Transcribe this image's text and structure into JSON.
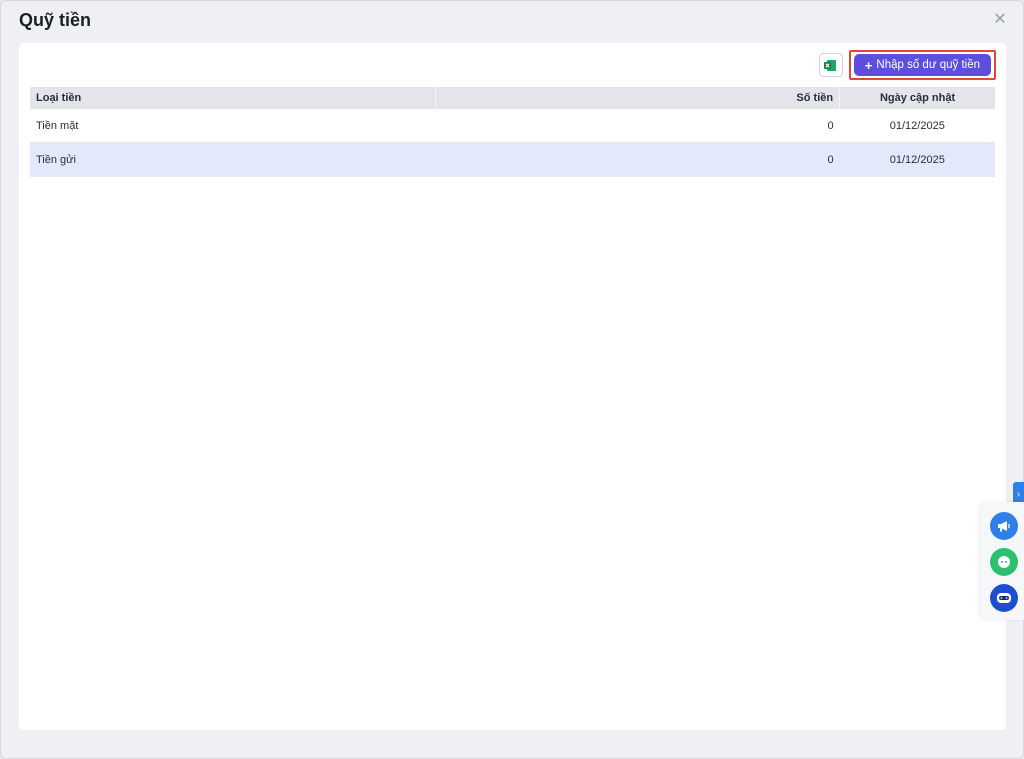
{
  "modal": {
    "title": "Quỹ tiền",
    "close_icon": "close-icon"
  },
  "toolbar": {
    "excel_icon": "excel-icon",
    "add_label": "Nhập số dư quỹ tiền"
  },
  "table": {
    "headers": [
      "Loại tiền",
      "Số tiền",
      "Ngày cập nhật"
    ],
    "rows": [
      {
        "type": "Tiền mặt",
        "amount": "0",
        "date": "01/12/2025",
        "selected": false
      },
      {
        "type": "Tiền gửi",
        "amount": "0",
        "date": "01/12/2025",
        "selected": true
      }
    ]
  },
  "floating": {
    "expand_icon": "chevron-right-icon",
    "buttons": [
      "megaphone-icon",
      "chat-icon",
      "bot-icon"
    ],
    "colors": [
      "#2f7fe8",
      "#2fbf71",
      "#1d4fd1"
    ]
  },
  "colors": {
    "primary": "#5b4fdc",
    "highlight_border": "#e0473b",
    "selected_row": "#e3e8fb"
  }
}
